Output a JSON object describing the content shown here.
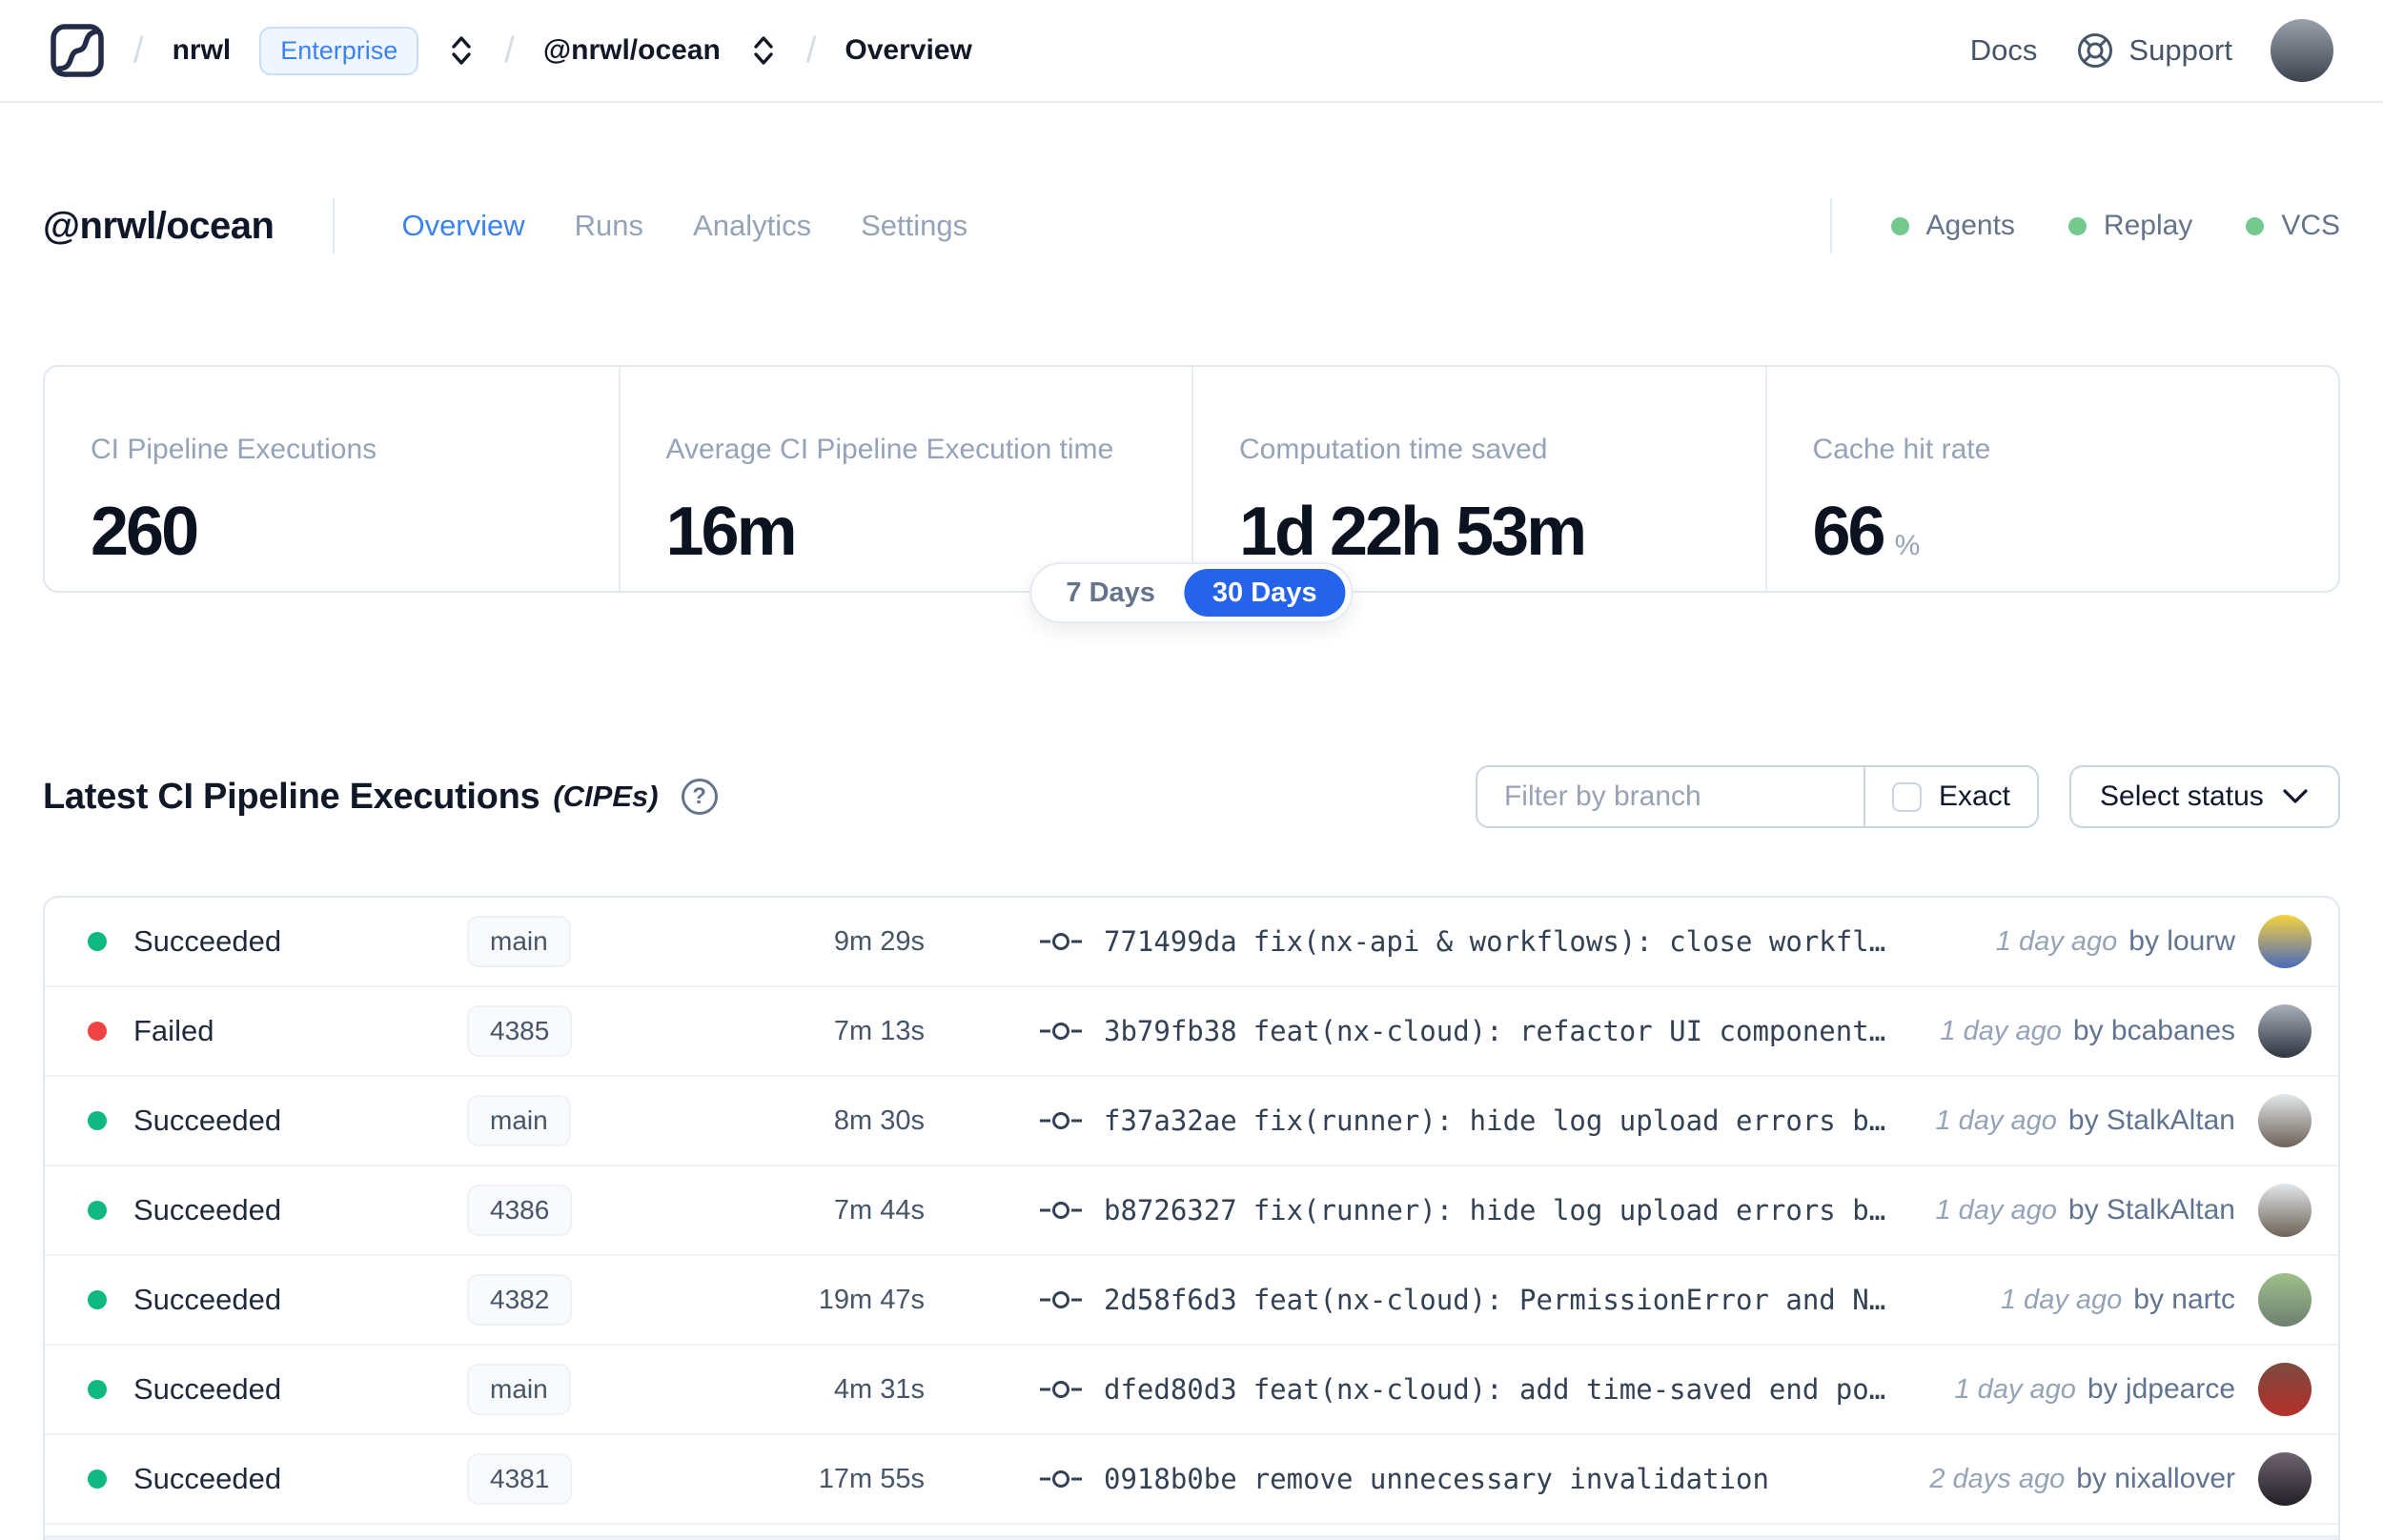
{
  "nav": {
    "breadcrumb": {
      "separator": "/",
      "org": "nrwl",
      "org_badge": "Enterprise",
      "workspace": "@nrwl/ocean",
      "page": "Overview"
    },
    "docs_label": "Docs",
    "support_label": "Support",
    "avatar_colors": [
      "#9aa1ab",
      "#3c434e"
    ]
  },
  "header": {
    "title": "@nrwl/ocean",
    "tabs": [
      {
        "label": "Overview",
        "active": true
      },
      {
        "label": "Runs",
        "active": false
      },
      {
        "label": "Analytics",
        "active": false
      },
      {
        "label": "Settings",
        "active": false
      }
    ],
    "status_dot_color": "#74c98e",
    "statuses": [
      {
        "label": "Agents"
      },
      {
        "label": "Replay"
      },
      {
        "label": "VCS"
      }
    ]
  },
  "stats": {
    "cards": [
      {
        "label": "CI Pipeline Executions",
        "value": "260",
        "unit": ""
      },
      {
        "label": "Average CI Pipeline Execution time",
        "value": "16m",
        "unit": ""
      },
      {
        "label": "Computation time saved",
        "value": "1d 22h 53m",
        "unit": ""
      },
      {
        "label": "Cache hit rate",
        "value": "66",
        "unit": "%"
      }
    ],
    "range_toggle": {
      "options": [
        "7 Days",
        "30 Days"
      ],
      "selected": "30 Days",
      "selected_color": "#2563eb"
    }
  },
  "cipes": {
    "title": "Latest CI Pipeline Executions",
    "title_suffix": "(CIPEs)",
    "help_glyph": "?",
    "filter_placeholder": "Filter by branch",
    "exact_label": "Exact",
    "status_dropdown_label": "Select status",
    "by_label": "by",
    "status_colors": {
      "succeeded": "#10b981",
      "failed": "#ef4444"
    },
    "rows": [
      {
        "status": "Succeeded",
        "dot_color": "#10b981",
        "branch": "main",
        "duration": "9m 29s",
        "commit_hash": "771499da",
        "commit_message": "fix(nx-api & workflows): close workfl…",
        "time_ago": "1 day ago",
        "author": "lourw",
        "avatar_colors": [
          "#f5d23e",
          "#4a69bd"
        ]
      },
      {
        "status": "Failed",
        "dot_color": "#ef4444",
        "branch": "4385",
        "duration": "7m 13s",
        "commit_hash": "3b79fb38",
        "commit_message": "feat(nx-cloud): refactor UI component…",
        "time_ago": "1 day ago",
        "author": "bcabanes",
        "avatar_colors": [
          "#a9b0ba",
          "#2e3440"
        ]
      },
      {
        "status": "Succeeded",
        "dot_color": "#10b981",
        "branch": "main",
        "duration": "8m 30s",
        "commit_hash": "f37a32ae",
        "commit_message": "fix(runner): hide log upload errors b…",
        "time_ago": "1 day ago",
        "author": "StalkAltan",
        "avatar_colors": [
          "#e3e7ea",
          "#6d6257"
        ]
      },
      {
        "status": "Succeeded",
        "dot_color": "#10b981",
        "branch": "4386",
        "duration": "7m 44s",
        "commit_hash": "b8726327",
        "commit_message": "fix(runner): hide log upload errors b…",
        "time_ago": "1 day ago",
        "author": "StalkAltan",
        "avatar_colors": [
          "#e3e7ea",
          "#6d6257"
        ]
      },
      {
        "status": "Succeeded",
        "dot_color": "#10b981",
        "branch": "4382",
        "duration": "19m 47s",
        "commit_hash": "2d58f6d3",
        "commit_message": "feat(nx-cloud): PermissionError and N…",
        "time_ago": "1 day ago",
        "author": "nartc",
        "avatar_colors": [
          "#9fc08b",
          "#6e7f72"
        ]
      },
      {
        "status": "Succeeded",
        "dot_color": "#10b981",
        "branch": "main",
        "duration": "4m 31s",
        "commit_hash": "dfed80d3",
        "commit_message": "feat(nx-cloud): add time-saved end po…",
        "time_ago": "1 day ago",
        "author": "jdpearce",
        "avatar_colors": [
          "#7d4a3f",
          "#b3302a"
        ]
      },
      {
        "status": "Succeeded",
        "dot_color": "#10b981",
        "branch": "4381",
        "duration": "17m 55s",
        "commit_hash": "0918b0be",
        "commit_message": "remove unnecessary invalidation",
        "time_ago": "2 days ago",
        "author": "nixallover",
        "avatar_colors": [
          "#6e6470",
          "#231f26"
        ]
      }
    ]
  }
}
